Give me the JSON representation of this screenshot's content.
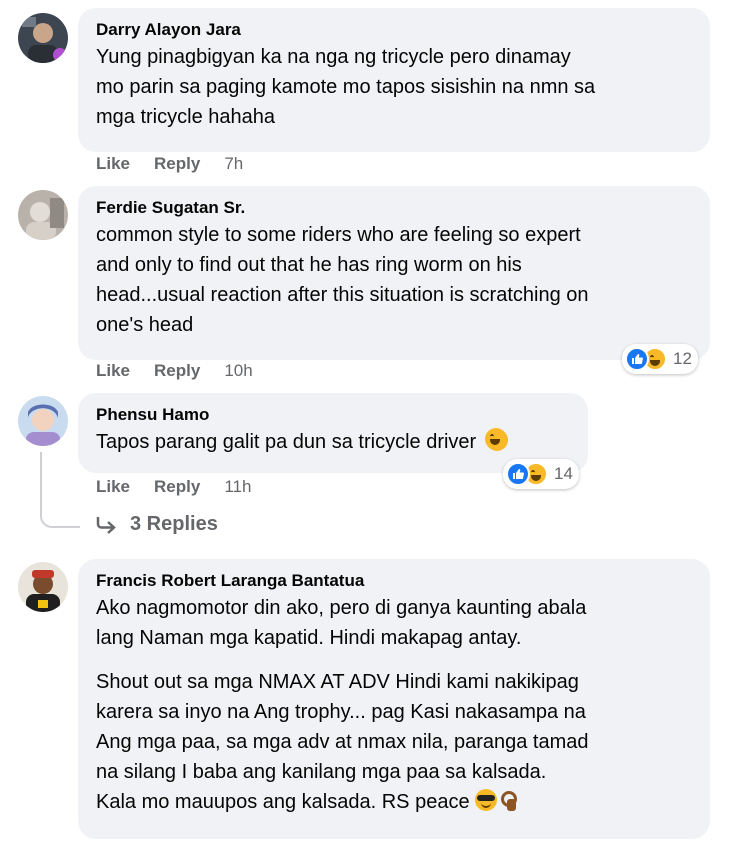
{
  "actions": {
    "like": "Like",
    "reply": "Reply"
  },
  "comments": [
    {
      "author": "Darry Alayon Jara",
      "text": [
        "Yung pinagbigyan ka na nga ng tricycle pero dinamay",
        "mo parin sa paging kamote mo tapos sisishin na nmn sa",
        "mga tricycle hahaha"
      ],
      "time": "7h"
    },
    {
      "author": "Ferdie Sugatan Sr.",
      "text": [
        "common style to some riders who are feeling so expert",
        "and only to find out that he has ring worm on his",
        "head...usual reaction after this situation is scratching on",
        "one's head"
      ],
      "time": "10h",
      "reaction_count": "12",
      "reaction_icons": [
        "like-icon",
        "haha-icon"
      ]
    },
    {
      "author": "Phensu Hamo",
      "text": [
        "Tapos parang galit pa dun sa tricycle driver"
      ],
      "time": "11h",
      "reaction_count": "14",
      "reaction_icons": [
        "like-icon",
        "haha-icon"
      ],
      "replies_label": "3 Replies"
    },
    {
      "author": "Francis Robert Laranga Bantatua",
      "paragraph1": [
        "Ako nagmomotor din ako, pero di ganya kaunting abala",
        "lang Naman mga kapatid. Hindi makapag antay."
      ],
      "paragraph2": [
        "Shout out sa mga NMAX AT ADV Hindi kami nakikipag",
        "karera sa inyo na Ang trophy... pag Kasi nakasampa na",
        "Ang mga paa, sa mga adv at nmax nila, paranga tamad",
        "na silang I baba ang kanilang mga paa sa kalsada.",
        "Kala mo mauupos ang kalsada. RS peace"
      ]
    }
  ],
  "colors": {
    "bubble": "#f0f2f5",
    "meta": "#65676b",
    "like_blue": "#1877f2",
    "haha_yellow": "#f7b928"
  }
}
